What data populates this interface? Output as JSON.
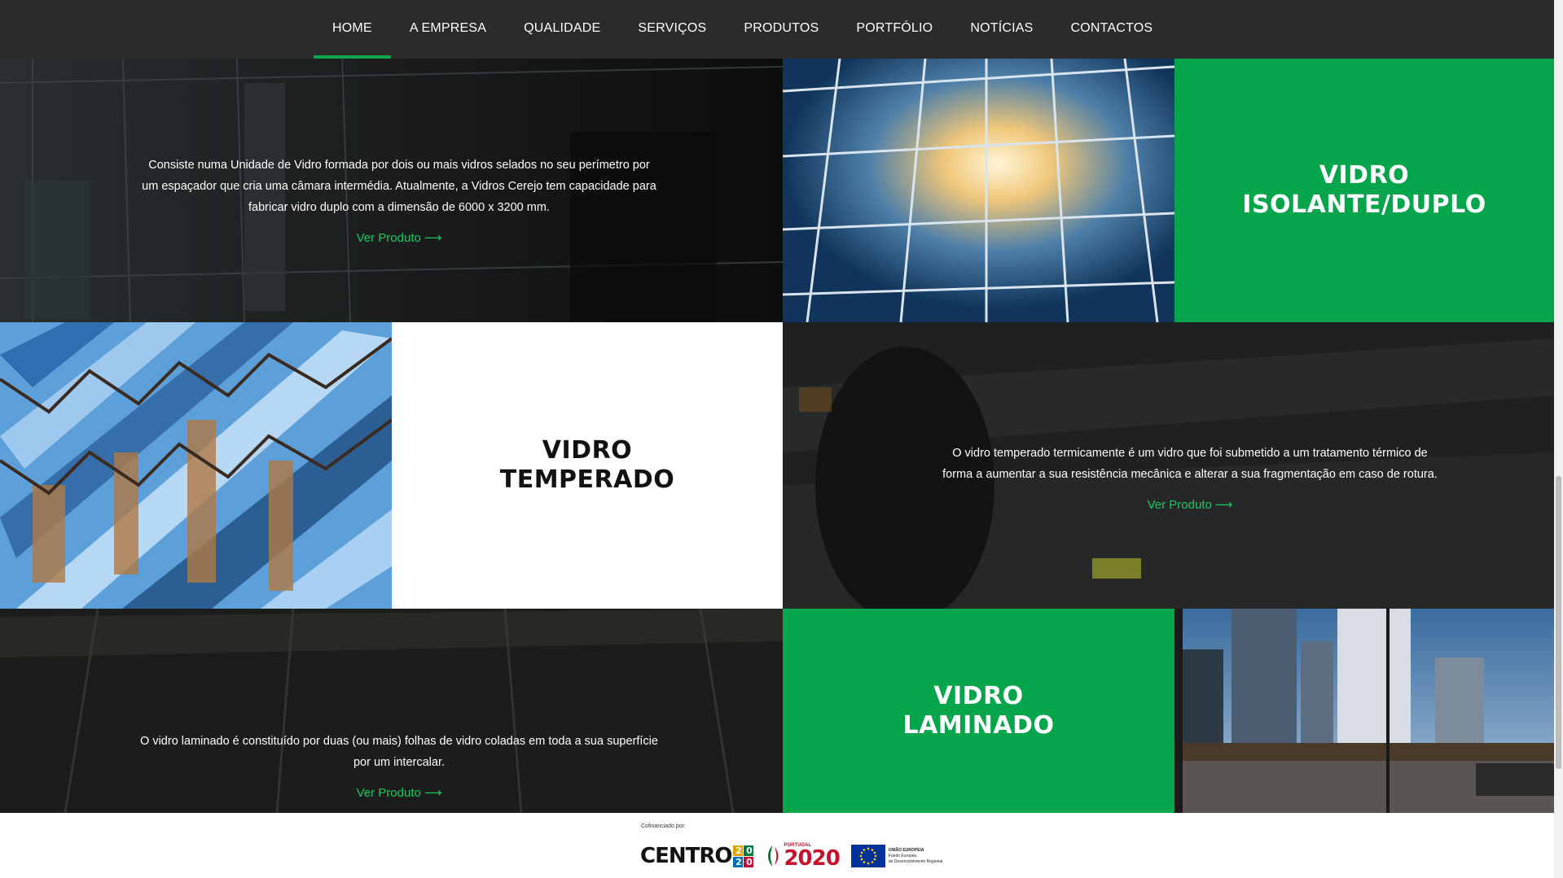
{
  "nav": {
    "items": [
      "HOME",
      "A EMPRESA",
      "QUALIDADE",
      "SERVIÇOS",
      "PRODUTOS",
      "PORTFÓLIO",
      "NOTÍCIAS",
      "CONTACTOS"
    ],
    "active_index": 0
  },
  "products": {
    "duplo": {
      "title_line1": "VIDRO",
      "title_line2": "ISOLANTE/DUPLO",
      "description_l1": "Consiste numa Unidade de Vidro formada por dois ou mais vidros selados no seu perímetro por",
      "description_l2": "um espaçador que cria uma câmara intermédia. Atualmente, a Vidros Cerejo tem capacidade para",
      "description_l3": "fabricar vidro duplo com a dimensão de 6000 x 3200 mm.",
      "link": "Ver Produto"
    },
    "temperado": {
      "title_line1": "VIDRO",
      "title_line2": "TEMPERADO",
      "description_l1": "O vidro temperado termicamente é um vidro que foi submetido a um tratamento térmico de",
      "description_l2": "forma a aumentar a sua resistência mecânica e alterar a sua fragmentação em caso de rotura.",
      "link": "Ver Produto"
    },
    "laminado": {
      "title_line1": "VIDRO",
      "title_line2": "LAMINADO",
      "description_l1": "O vidro laminado é constituído por duas (ou mais) folhas de vidro coladas em toda a sua superfície",
      "description_l2": "por um intercalar.",
      "link": "Ver Produto"
    }
  },
  "footer": {
    "cofinanciado": "Cofinanciado por:",
    "logo_centro": "CENTRO",
    "logo_centro_digits": [
      "2",
      "0",
      "2",
      "0"
    ],
    "logo_portugal_small": "PORTUGAL",
    "logo_portugal_big": "2020",
    "logo_eu_l1": "UNIÃO EUROPEIA",
    "logo_eu_l2": "Fundo Europeu",
    "logo_eu_l3": "de Desenvolvimento Regional"
  },
  "colors": {
    "accent_green": "#05a54b",
    "link_green": "#19c860",
    "nav_bg": "#2b2b2b"
  },
  "icons": {
    "link_arrow": "arrow-right-icon"
  }
}
